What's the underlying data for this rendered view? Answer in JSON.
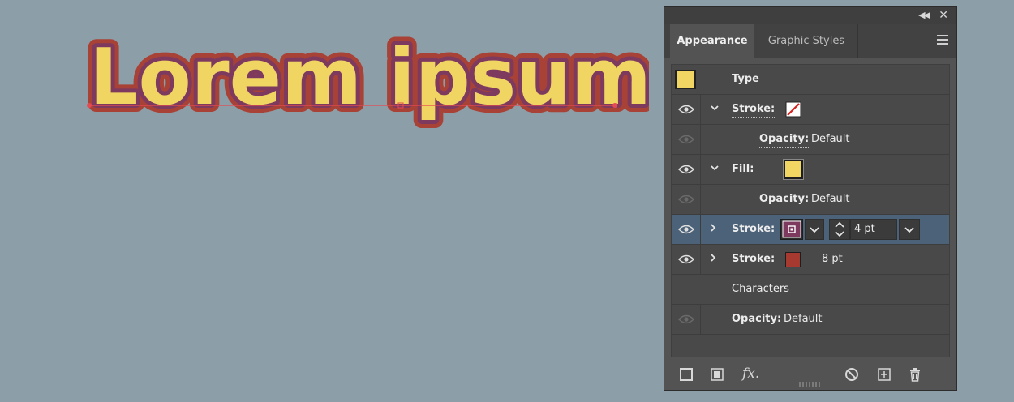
{
  "artwork": {
    "text": "Lorem ipsum",
    "fill_color": "#f0d562",
    "inner_stroke_color": "#7d3a5e",
    "outer_stroke_color": "#a84236",
    "baseline_color": "#e64a52"
  },
  "panel": {
    "tabs": [
      {
        "label": "Appearance",
        "active": true
      },
      {
        "label": "Graphic Styles",
        "active": false
      }
    ],
    "header": {
      "label": "Type",
      "swatch_color": "#f2d663"
    },
    "rows": {
      "stroke_none": {
        "label": "Stroke:"
      },
      "opacity_1": {
        "label": "Opacity:",
        "value": "Default"
      },
      "fill": {
        "label": "Fill:",
        "swatch_color": "#f2d663"
      },
      "opacity_2": {
        "label": "Opacity:",
        "value": "Default"
      },
      "stroke_selected": {
        "label": "Stroke:",
        "weight": "4 pt",
        "swatch_color": "#7d3a5e"
      },
      "stroke_8pt": {
        "label": "Stroke:",
        "weight": "8 pt",
        "swatch_color": "#a63a30"
      },
      "characters": {
        "label": "Characters"
      },
      "opacity_3": {
        "label": "Opacity:",
        "value": "Default"
      }
    },
    "bottom_icons": [
      "new-stroke-icon",
      "new-fill-icon",
      "fx-icon",
      "clear-icon",
      "duplicate-icon",
      "delete-icon"
    ],
    "fx_label": "fx."
  }
}
